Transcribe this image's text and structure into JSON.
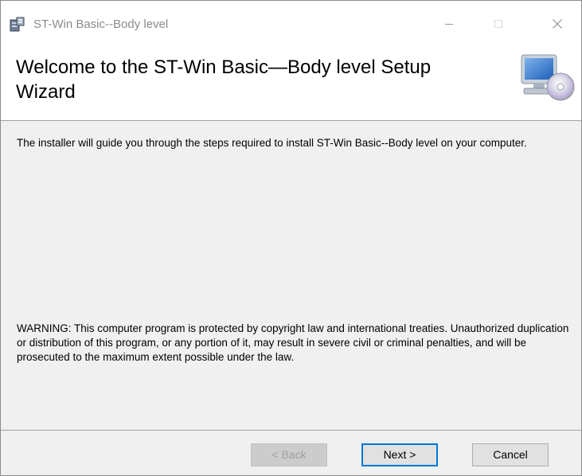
{
  "window": {
    "title": "ST-Win Basic--Body level"
  },
  "header": {
    "title": "Welcome to the ST-Win Basic—Body level Setup Wizard"
  },
  "body": {
    "intro": "The installer will guide you through the steps required to install ST-Win Basic--Body level on your computer.",
    "warning": "WARNING: This computer program is protected by copyright law and international treaties. Unauthorized duplication or distribution of this program, or any portion of it, may result in severe civil or criminal penalties, and will be prosecuted to the maximum extent possible under the law."
  },
  "buttons": {
    "back": "< Back",
    "next": "Next >",
    "cancel": "Cancel"
  },
  "icons": {
    "app": "installer-app-icon",
    "header": "computer-cd-icon",
    "minimize": "minimize-icon",
    "maximize": "maximize-icon",
    "close": "close-icon"
  },
  "colors": {
    "accent": "#0078d7",
    "body_bg": "#f0f0f0"
  }
}
